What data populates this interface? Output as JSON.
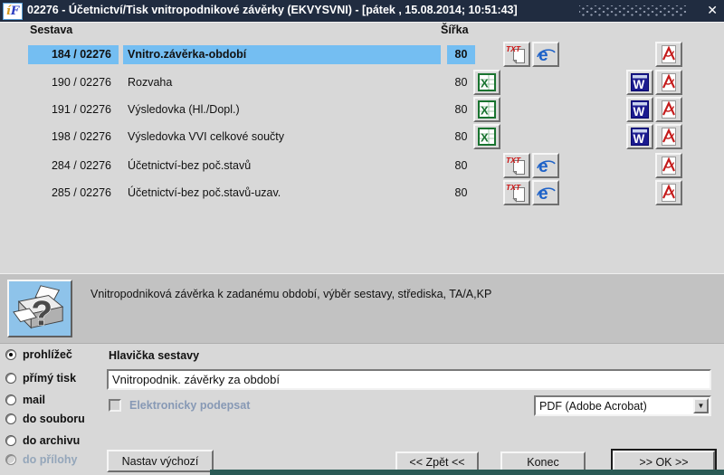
{
  "title_bar": {
    "logo_i": "í",
    "logo_f": "F",
    "title": "02276 - Účetnictví/Tisk vnitropodnikové závěrky (EKVYSVNI) - [pátek , 15.08.2014; 10:51:43]",
    "close_glyph": "✕"
  },
  "table": {
    "col_sestava": "Sestava",
    "col_sirka": "Šířka",
    "rows": [
      {
        "code": "184 / 02276",
        "name": "Vnitro.závěrka-období",
        "width": "80",
        "selected": true,
        "icons": [
          "txt",
          "ie"
        ],
        "export_icons": [
          "pdf"
        ]
      },
      {
        "code": "190 / 02276",
        "name": "Rozvaha",
        "width": "80",
        "selected": false,
        "icons": [
          "excel"
        ],
        "export_icons": [
          "word",
          "pdf"
        ]
      },
      {
        "code": "191 / 02276",
        "name": "Výsledovka (Hl./Dopl.)",
        "width": "80",
        "selected": false,
        "icons": [
          "excel"
        ],
        "export_icons": [
          "word",
          "pdf"
        ]
      },
      {
        "code": "198 / 02276",
        "name": "Výsledovka VVI celkové součty",
        "width": "80",
        "selected": false,
        "icons": [
          "excel"
        ],
        "export_icons": [
          "word",
          "pdf"
        ]
      },
      {
        "code": "284 / 02276",
        "name": "Účetnictví-bez poč.stavů",
        "width": "80",
        "selected": false,
        "icons": [
          "txt",
          "ie"
        ],
        "export_icons": [
          "pdf"
        ]
      },
      {
        "code": "285 / 02276",
        "name": "Účetnictví-bez poč.stavů-uzav.",
        "width": "80",
        "selected": false,
        "icons": [
          "txt",
          "ie"
        ],
        "export_icons": [
          "pdf"
        ]
      }
    ]
  },
  "info_panel": {
    "icon": "printer-question-icon",
    "description": "Vnitropodniková závěrka k zadanému období, výběr sestavy, střediska, TA/A,KP"
  },
  "output_options": {
    "radios": [
      {
        "label": "prohlížeč",
        "selected": true,
        "disabled": false
      },
      {
        "label": "přímý tisk",
        "selected": false,
        "disabled": false
      },
      {
        "label": "mail",
        "selected": false,
        "disabled": false
      },
      {
        "label": "do souboru",
        "selected": false,
        "disabled": false
      },
      {
        "label": "do archivu",
        "selected": false,
        "disabled": false
      },
      {
        "label": "do přílohy",
        "selected": false,
        "disabled": true
      }
    ]
  },
  "form": {
    "header_label": "Hlavička sestavy",
    "header_value": "Vnitropodnik. závěrky za období",
    "sign_label": "Elektronicky podepsat",
    "sign_checked": false,
    "format_value": "PDF (Adobe Acrobat)",
    "combo_arrow_glyph": "▼"
  },
  "buttons": {
    "set_default": "Nastav výchozí",
    "back": "<< Zpět <<",
    "end": "Konec",
    "ok": ">> OK >>"
  },
  "colors": {
    "titlebar_bg": "#202c40",
    "body_bg": "#d8d8d8",
    "band_bg": "#c2c2c2",
    "selection_bg": "#74bef2",
    "printer_btn_bg": "#8ec3ea",
    "teal_strip": "#2a5a55"
  }
}
